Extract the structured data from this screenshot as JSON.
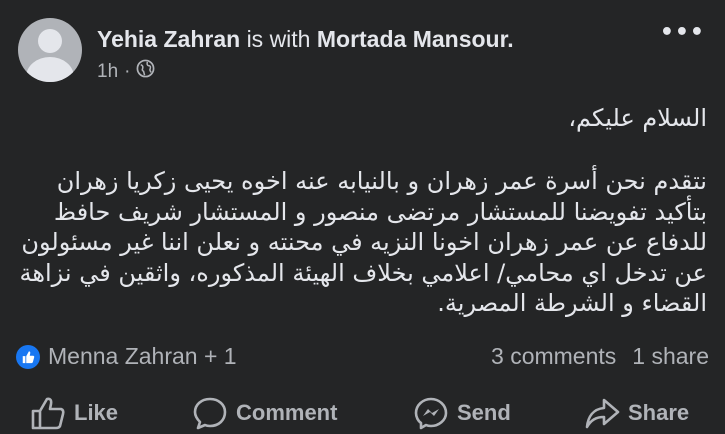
{
  "post": {
    "author": "Yehia Zahran",
    "with_text": "is with",
    "tagged": "Mortada Mansour.",
    "time": "1h",
    "separator": "·",
    "privacy_icon": "globe-icon",
    "more_label": "•••",
    "greeting": "السلام عليكم،",
    "body": "نتقدم نحن أسرة عمر زهران و بالنيابه عنه اخوه يحيى زكريا زهران بتأكيد تفويضنا للمستشار مرتضى منصور و المستشار شريف حافظ للدفاع عن عمر زهران اخونا النزيه في محنته و نعلن اننا غير مسئولون عن تدخل اي محامي/ اعلامي بخلاف الهيئة المذكوره، واثقين في نزاهة القضاء و الشرطة المصرية."
  },
  "stats": {
    "reactors": "Menna Zahran + 1",
    "comments": "3 comments",
    "shares": "1 share"
  },
  "actions": {
    "like": "Like",
    "comment": "Comment",
    "send": "Send",
    "share": "Share"
  },
  "colors": {
    "background": "#242526",
    "text": "#e4e6eb",
    "secondary": "#b0b3b8",
    "like_blue": "#1877f2"
  }
}
